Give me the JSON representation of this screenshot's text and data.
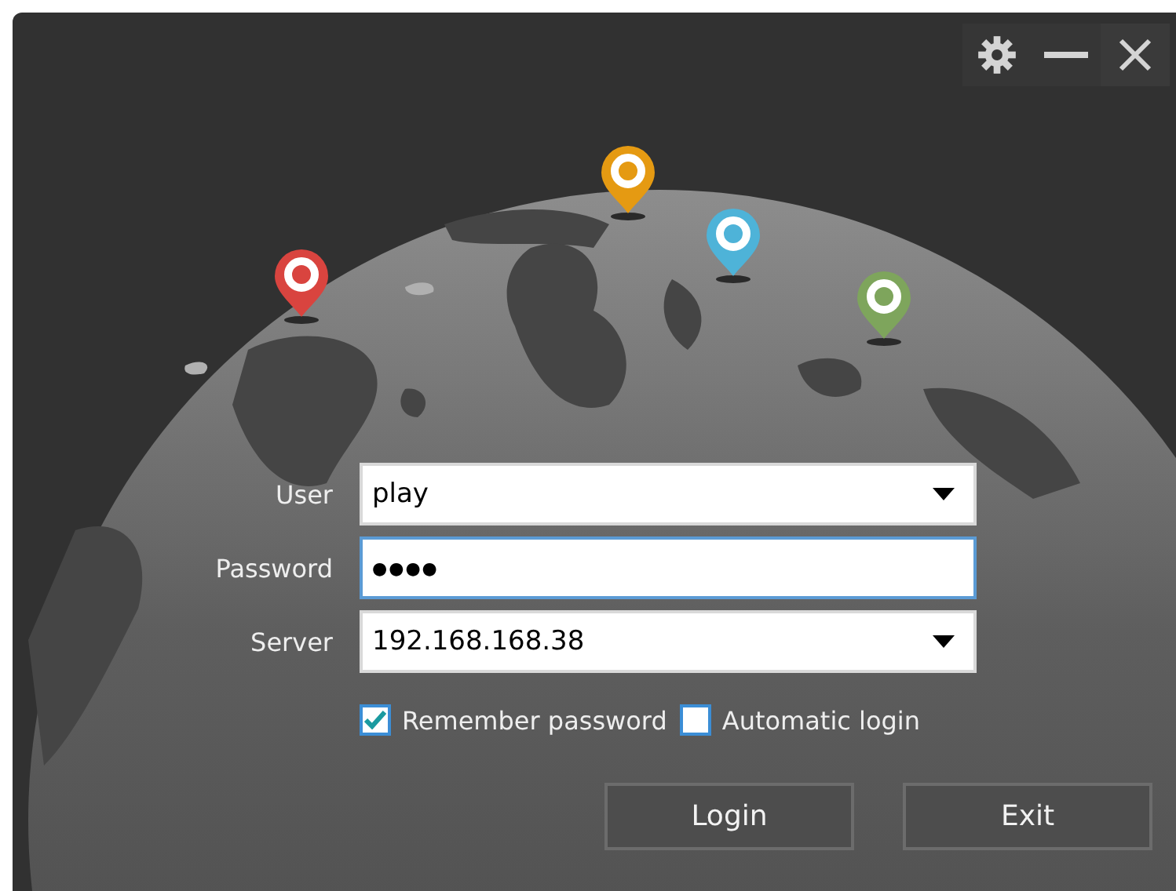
{
  "window_controls": [
    {
      "kind": "settings"
    },
    {
      "kind": "minimize"
    },
    {
      "kind": "close"
    }
  ],
  "fields": [
    {
      "label": "User",
      "value": "play",
      "kind": "dropdown",
      "focused": false
    },
    {
      "label": "Password",
      "value": "●●●●",
      "kind": "password",
      "focused": true
    },
    {
      "label": "Server",
      "value": "192.168.168.38",
      "kind": "dropdown",
      "focused": false
    }
  ],
  "options": [
    {
      "label": "Remember password",
      "checked": true
    },
    {
      "label": "Automatic login",
      "checked": false
    }
  ],
  "buttons": [
    "Login",
    "Exit"
  ]
}
